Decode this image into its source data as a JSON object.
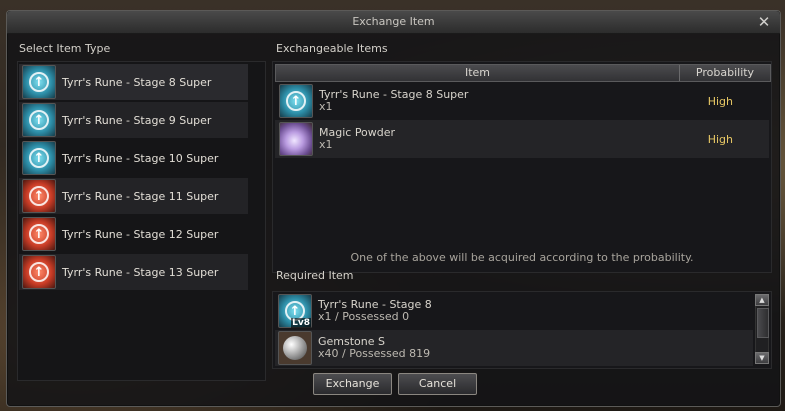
{
  "window": {
    "title": "Exchange Item",
    "close_symbol": "✕"
  },
  "left": {
    "label": "Select Item Type",
    "items": [
      {
        "label": "Tyrr's Rune - Stage 8 Super",
        "icon": "blue-rune-icon"
      },
      {
        "label": "Tyrr's Rune - Stage 9 Super",
        "icon": "blue-rune-icon"
      },
      {
        "label": "Tyrr's Rune - Stage 10 Super",
        "icon": "blue-rune-icon"
      },
      {
        "label": "Tyrr's Rune - Stage 11 Super",
        "icon": "red-rune-icon"
      },
      {
        "label": "Tyrr's Rune - Stage 12 Super",
        "icon": "red-rune-icon"
      },
      {
        "label": "Tyrr's Rune - Stage 13 Super",
        "icon": "red-rune-icon"
      }
    ]
  },
  "exchangeable": {
    "label": "Exchangeable Items",
    "columns": {
      "item": "Item",
      "probability": "Probability"
    },
    "rows": [
      {
        "name": "Tyrr's Rune - Stage 8 Super",
        "qty": "x1",
        "probability": "High",
        "icon": "blue-rune-icon"
      },
      {
        "name": "Magic Powder",
        "qty": "x1",
        "probability": "High",
        "icon": "magic-powder-icon"
      }
    ],
    "note": "One of the above will be acquired according to the probability."
  },
  "required": {
    "label": "Required Item",
    "rows": [
      {
        "name": "Tyrr's Rune - Stage 8",
        "detail": "x1 / Possessed 0",
        "badge": "Lv8",
        "icon": "blue-rune-icon"
      },
      {
        "name": "Gemstone S",
        "detail": "x40 / Possessed 819",
        "icon": "gemstone-icon"
      }
    ]
  },
  "buttons": {
    "exchange": "Exchange",
    "cancel": "Cancel"
  },
  "colors": {
    "probability_high": "#e8c865",
    "accent_blue_rune": "#2d8ea8",
    "accent_red_rune": "#c83c26"
  }
}
